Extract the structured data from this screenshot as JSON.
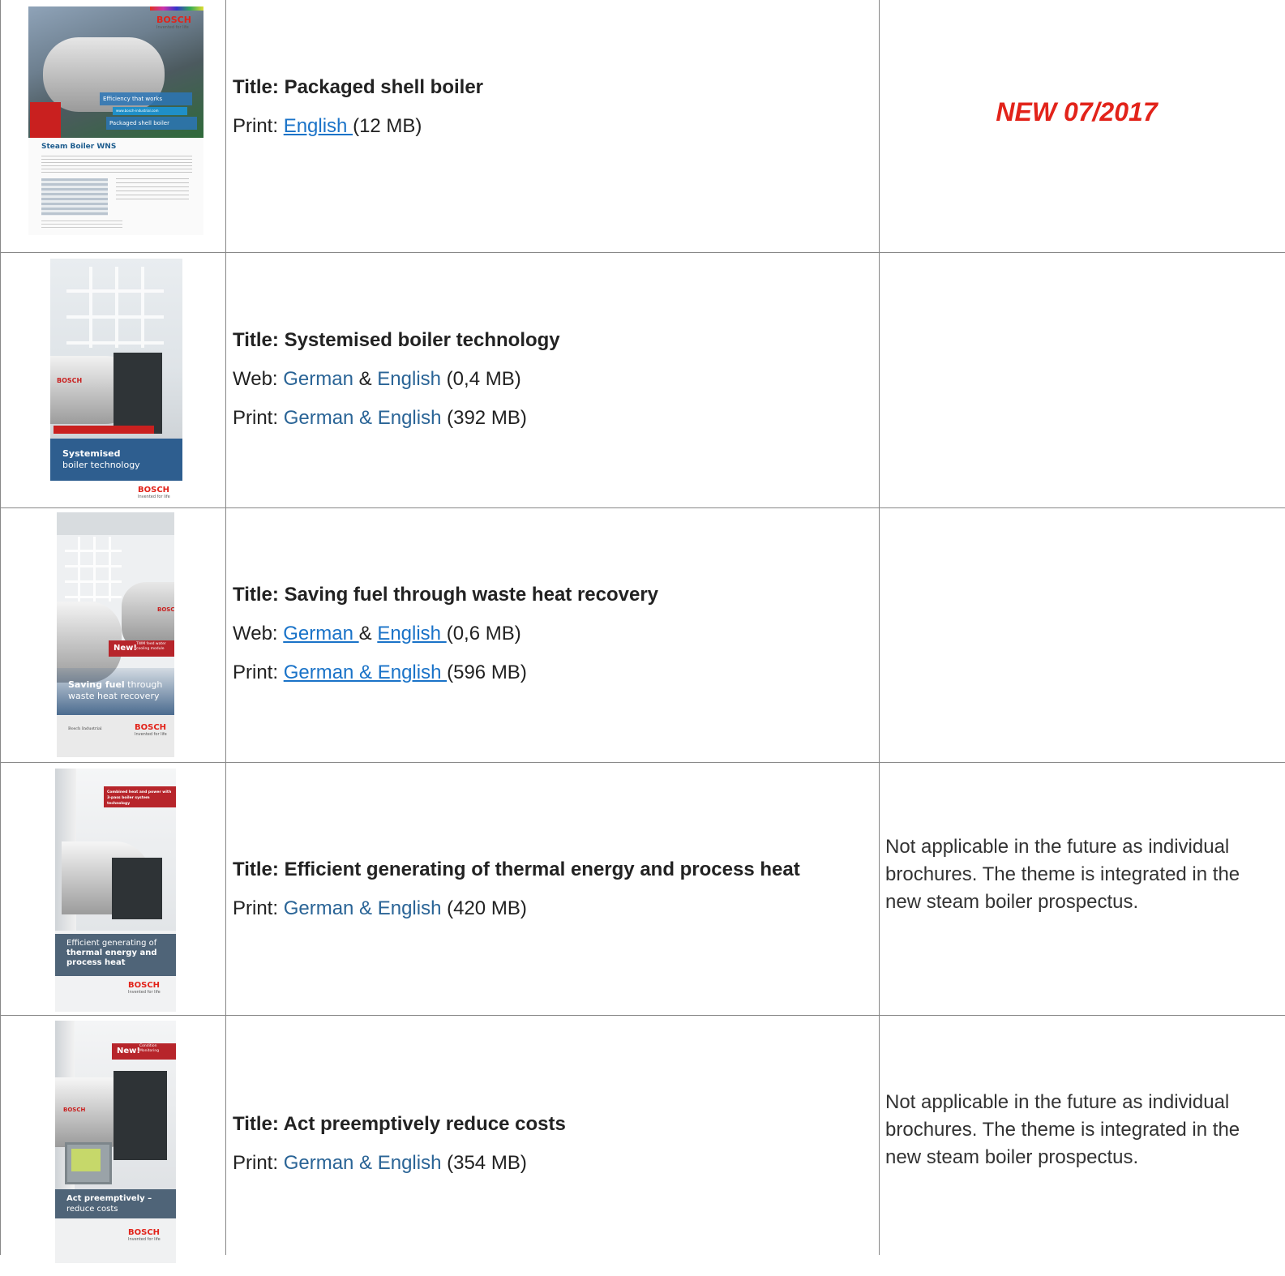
{
  "colors": {
    "link": "#2a6496",
    "link_underlined": "#1a73c8",
    "new_tag": "#e2231a",
    "grid": "#888888"
  },
  "rows": [
    {
      "title": "Title: Packaged shell boiler",
      "print_prefix": "Print: ",
      "print_link": "English ",
      "print_size": "(12 MB)",
      "new_tag": "NEW 07/2017",
      "cover": {
        "logo": "BOSCH",
        "tagline": "Invented for life",
        "overlay1": "Efficiency that works",
        "overlay2": "www.bosch-industrial.com",
        "overlay3": "Packaged shell boiler",
        "heading": "Steam Boiler WNS"
      }
    },
    {
      "title": "Title: Systemised boiler technology",
      "web_prefix": "Web: ",
      "web_link1": "German",
      "web_amp": " & ",
      "web_link2": "English",
      "web_size": " (0,4 MB)",
      "print_prefix": "Print: ",
      "print_link": "German & English",
      "print_size": " (392 MB)",
      "cover": {
        "band1": "Systemised",
        "band2": "boiler technology",
        "logo": "BOSCH",
        "tagline": "Invented for life",
        "boiler_logo": "BOSCH"
      }
    },
    {
      "title": "Title: Saving fuel through waste heat recovery",
      "web_prefix": "Web: ",
      "web_link1": "German ",
      "web_amp": "& ",
      "web_link2": "English ",
      "web_size": "(0,6 MB)",
      "print_prefix": "Print: ",
      "print_link": "German & English ",
      "print_size": "(596 MB)",
      "cover": {
        "new": "New!",
        "new_sub": "TWM feed water cooling module",
        "band1": "Saving fuel",
        "band1b": " through",
        "band2": "waste heat recovery",
        "footer": "Bosch Industrial",
        "logo": "BOSCH",
        "tagline": "Invented for life",
        "boiler_logo": "BOSCH"
      }
    },
    {
      "title": "Title: Efficient generating of thermal energy and process heat",
      "print_prefix": "Print: ",
      "print_link": "German & English",
      "print_size": " (420 MB)",
      "note": "Not applicable in the future as individual brochures. The theme is integrated in the new steam boiler prospectus.",
      "cover": {
        "tag": "Combined heat and power with 3-pass boiler system technology",
        "band1": "Efficient generating of",
        "band2": "thermal energy and",
        "band3": "process heat",
        "logo": "BOSCH",
        "tagline": "Invented for life"
      }
    },
    {
      "title": "Title: Act preemptively reduce costs",
      "print_prefix": "Print: ",
      "print_link": "German & English",
      "print_size": " (354 MB)",
      "note": "Not applicable in the future as individual brochures. The theme is integrated in the new steam boiler prospectus.",
      "cover": {
        "new": "New!",
        "new_sub": "Condition Monitoring",
        "band1": "Act preemptively –",
        "band2": "reduce costs",
        "logo": "BOSCH",
        "tagline": "Invented for life",
        "boiler_logo": "BOSCH"
      }
    }
  ]
}
